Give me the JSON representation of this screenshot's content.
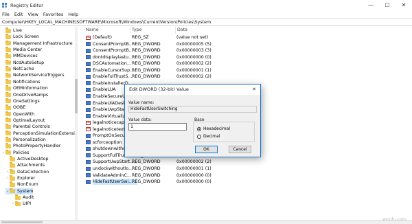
{
  "window": {
    "title": "Registry Editor"
  },
  "menu": [
    "File",
    "Edit",
    "View",
    "Favorites",
    "Help"
  ],
  "address": "Computer\\HKEY_LOCAL_MACHINE\\SOFTWARE\\Microsoft\\Windows\\CurrentVersion\\Policies\\System",
  "tree": [
    {
      "label": "Live",
      "level": 1,
      "expander": ""
    },
    {
      "label": "Lock Screen",
      "level": 1,
      "expander": ""
    },
    {
      "label": "Management Infrastructure",
      "level": 1,
      "expander": ""
    },
    {
      "label": "Media Center",
      "level": 1,
      "expander": ""
    },
    {
      "label": "MMDevices",
      "level": 1,
      "expander": ""
    },
    {
      "label": "NcdAutoSetup",
      "level": 1,
      "expander": ""
    },
    {
      "label": "NetCache",
      "level": 1,
      "expander": ""
    },
    {
      "label": "NetworkServiceTriggers",
      "level": 1,
      "expander": ""
    },
    {
      "label": "Notifications",
      "level": 1,
      "expander": ""
    },
    {
      "label": "OEMInformation",
      "level": 1,
      "expander": ""
    },
    {
      "label": "OneDriveRamps",
      "level": 1,
      "expander": ""
    },
    {
      "label": "OneSettings",
      "level": 1,
      "expander": ""
    },
    {
      "label": "OOBE",
      "level": 1,
      "expander": ""
    },
    {
      "label": "OpenWith",
      "level": 1,
      "expander": ""
    },
    {
      "label": "OptimalLayout",
      "level": 1,
      "expander": ""
    },
    {
      "label": "Parental Controls",
      "level": 1,
      "expander": ""
    },
    {
      "label": "PerceptionSimulationExtensions",
      "level": 1,
      "expander": ""
    },
    {
      "label": "Personalization",
      "level": 1,
      "expander": ""
    },
    {
      "label": "PhotoPropertyHandler",
      "level": 1,
      "expander": ""
    },
    {
      "label": "Policies",
      "level": 1,
      "expander": "⌄"
    },
    {
      "label": "ActiveDesktop",
      "level": 2,
      "expander": ""
    },
    {
      "label": "Attachments",
      "level": 2,
      "expander": ""
    },
    {
      "label": "DataCollection",
      "level": 2,
      "expander": "›"
    },
    {
      "label": "Explorer",
      "level": 2,
      "expander": "›"
    },
    {
      "label": "NonEnum",
      "level": 2,
      "expander": ""
    },
    {
      "label": "System",
      "level": 2,
      "expander": "⌄",
      "selected": true
    },
    {
      "label": "Audit",
      "level": 3,
      "expander": ""
    },
    {
      "label": "UIPI",
      "level": 3,
      "expander": "›"
    }
  ],
  "columns": {
    "name": "Name",
    "type": "Type",
    "data": "Data"
  },
  "values": [
    {
      "name": "(Default)",
      "type": "REG_SZ",
      "data": "(value not set)",
      "kind": "sz"
    },
    {
      "name": "ConsentPromptB...",
      "type": "REG_DWORD",
      "data": "0x00000005 (5)",
      "kind": "dw"
    },
    {
      "name": "ConsentPromptB...",
      "type": "REG_DWORD",
      "data": "0x00000003 (3)",
      "kind": "dw"
    },
    {
      "name": "dontdisplaylastu...",
      "type": "REG_DWORD",
      "data": "0x00000000 (0)",
      "kind": "dw"
    },
    {
      "name": "DSCAutomation...",
      "type": "REG_DWORD",
      "data": "0x00000002 (2)",
      "kind": "dw"
    },
    {
      "name": "EnableCursorSup...",
      "type": "REG_DWORD",
      "data": "0x00000001 (1)",
      "kind": "dw"
    },
    {
      "name": "EnableFullTrustS...",
      "type": "REG_DWORD",
      "data": "0x00000002 (2)",
      "kind": "dw"
    },
    {
      "name": "EnableInstallerD...",
      "type": "",
      "data": "",
      "kind": "dw"
    },
    {
      "name": "EnableLUA",
      "type": "",
      "data": "",
      "kind": "dw"
    },
    {
      "name": "EnableSecureUIA...",
      "type": "",
      "data": "",
      "kind": "dw"
    },
    {
      "name": "EnableUIADeskt...",
      "type": "",
      "data": "",
      "kind": "dw"
    },
    {
      "name": "EnableUwpStart...",
      "type": "",
      "data": "",
      "kind": "dw"
    },
    {
      "name": "EnableVirtualizat...",
      "type": "",
      "data": "",
      "kind": "dw"
    },
    {
      "name": "legalnoticecapti...",
      "type": "",
      "data": "",
      "kind": "sz"
    },
    {
      "name": "legalnoticetext",
      "type": "",
      "data": "",
      "kind": "sz"
    },
    {
      "name": "PromptOnSecure...",
      "type": "",
      "data": "",
      "kind": "dw"
    },
    {
      "name": "scforceoption",
      "type": "",
      "data": "",
      "kind": "dw"
    },
    {
      "name": "shutdownwithou...",
      "type": "REG_DWORD",
      "data": "0x00000001 (1)",
      "kind": "dw"
    },
    {
      "name": "SupportFullTrust...",
      "type": "REG_DWORD",
      "data": "0x00000001 (1)",
      "kind": "dw"
    },
    {
      "name": "SupportUwpStart...",
      "type": "REG_DWORD",
      "data": "0x00000002 (2)",
      "kind": "dw"
    },
    {
      "name": "undockwithoutlo...",
      "type": "REG_DWORD",
      "data": "0x00000001 (1)",
      "kind": "dw"
    },
    {
      "name": "ValidateAdminC...",
      "type": "REG_DWORD",
      "data": "0x00000000 (0)",
      "kind": "dw"
    },
    {
      "name": "HideFastUserSwi...",
      "type": "REG_DWORD",
      "data": "0x00000000 (0)",
      "kind": "dw",
      "selected": true
    }
  ],
  "dialog": {
    "title": "Edit DWORD (32-bit) Value",
    "value_name_label": "Value name:",
    "value_name": "HideFastUserSwitching",
    "value_data_label": "Value data:",
    "value_data": "1",
    "base_label": "Base",
    "hex_label": "Hexadecimal",
    "dec_label": "Decimal",
    "base_selected": "Hexadecimal",
    "ok_label": "OK",
    "cancel_label": "Cancel"
  },
  "watermark": "wsxdn.com"
}
